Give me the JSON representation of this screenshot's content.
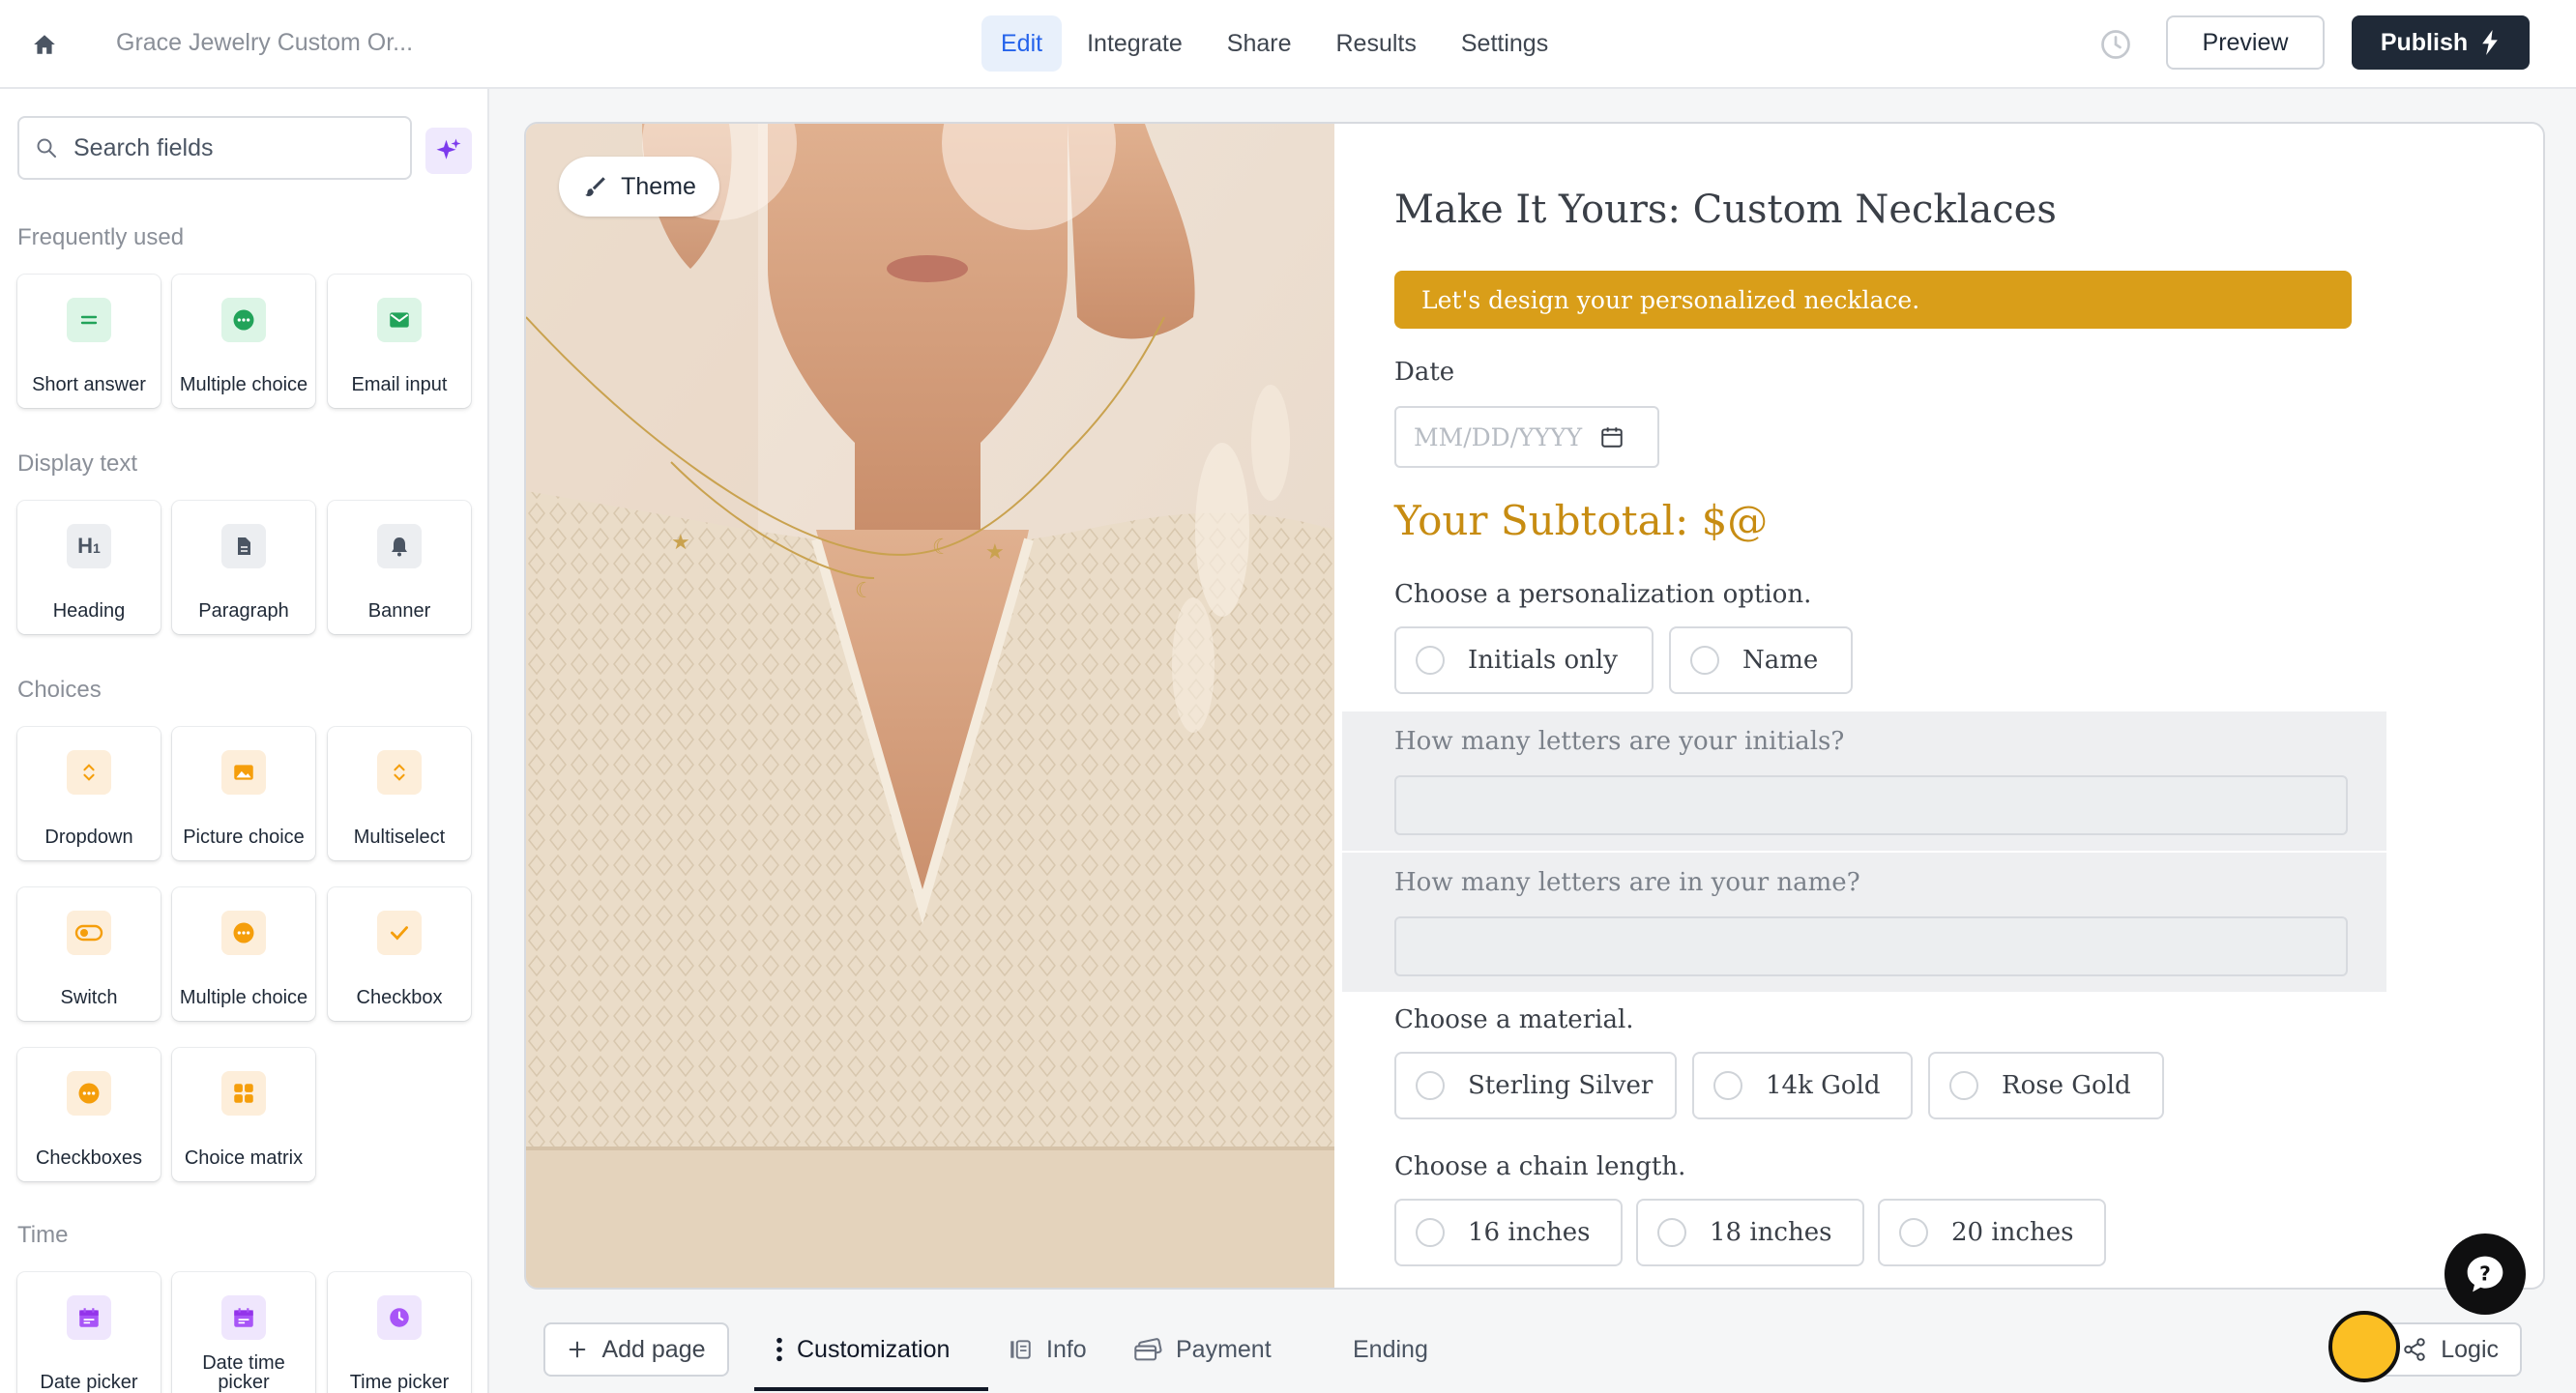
{
  "header": {
    "form_title": "Grace Jewelry Custom Or...",
    "tabs": [
      {
        "label": "Edit",
        "active": true
      },
      {
        "label": "Integrate",
        "active": false
      },
      {
        "label": "Share",
        "active": false
      },
      {
        "label": "Results",
        "active": false
      },
      {
        "label": "Settings",
        "active": false
      }
    ],
    "preview_label": "Preview",
    "publish_label": "Publish"
  },
  "sidebar": {
    "search_placeholder": "Search fields",
    "sections": [
      {
        "title": "Frequently used",
        "items": [
          {
            "label": "Short answer",
            "icon": "short-answer-icon"
          },
          {
            "label": "Multiple choice",
            "icon": "multiple-choice-icon"
          },
          {
            "label": "Email input",
            "icon": "email-icon"
          }
        ]
      },
      {
        "title": "Display text",
        "items": [
          {
            "label": "Heading",
            "icon": "heading-icon"
          },
          {
            "label": "Paragraph",
            "icon": "paragraph-icon"
          },
          {
            "label": "Banner",
            "icon": "bell-icon"
          }
        ]
      },
      {
        "title": "Choices",
        "items": [
          {
            "label": "Dropdown",
            "icon": "dropdown-icon"
          },
          {
            "label": "Picture choice",
            "icon": "picture-icon"
          },
          {
            "label": "Multiselect",
            "icon": "multiselect-icon"
          },
          {
            "label": "Switch",
            "icon": "switch-icon"
          },
          {
            "label": "Multiple choice",
            "icon": "multiple-choice-icon"
          },
          {
            "label": "Checkbox",
            "icon": "check-icon"
          },
          {
            "label": "Checkboxes",
            "icon": "checkboxes-icon"
          },
          {
            "label": "Choice matrix",
            "icon": "matrix-icon"
          }
        ]
      },
      {
        "title": "Time",
        "items": [
          {
            "label": "Date picker",
            "icon": "calendar-icon"
          },
          {
            "label": "Date time picker",
            "icon": "calendar-time-icon"
          },
          {
            "label": "Time picker",
            "icon": "clock-icon"
          }
        ]
      }
    ]
  },
  "canvas": {
    "theme_label": "Theme",
    "form": {
      "heading": "Make It Yours: Custom Necklaces",
      "banner": "Let's design your personalized necklace.",
      "date_label": "Date",
      "date_placeholder": "MM/DD/YYYY",
      "subtotal": "Your Subtotal: $@",
      "personalization_label": "Choose a personalization option.",
      "personalization_options": [
        "Initials only",
        "Name"
      ],
      "initials_question": "How many letters are your initials?",
      "name_question": "How many letters are in your name?",
      "material_label": "Choose a material.",
      "material_options": [
        "Sterling Silver",
        "14k Gold",
        "Rose Gold"
      ],
      "chain_label": "Choose a chain length.",
      "chain_options": [
        "16 inches",
        "18 inches",
        "20 inches"
      ]
    }
  },
  "bottom": {
    "add_page_label": "Add page",
    "pages": [
      {
        "label": "Customization",
        "active": true
      },
      {
        "label": "Info",
        "active": false
      },
      {
        "label": "Payment",
        "active": false
      },
      {
        "label": "Ending",
        "active": false
      }
    ],
    "logic_label": "Logic"
  },
  "colors": {
    "accent_blue": "#2563eb",
    "banner_gold": "#d99e19",
    "subtotal_gold": "#c78c12",
    "publish_dark": "#1f2937"
  }
}
